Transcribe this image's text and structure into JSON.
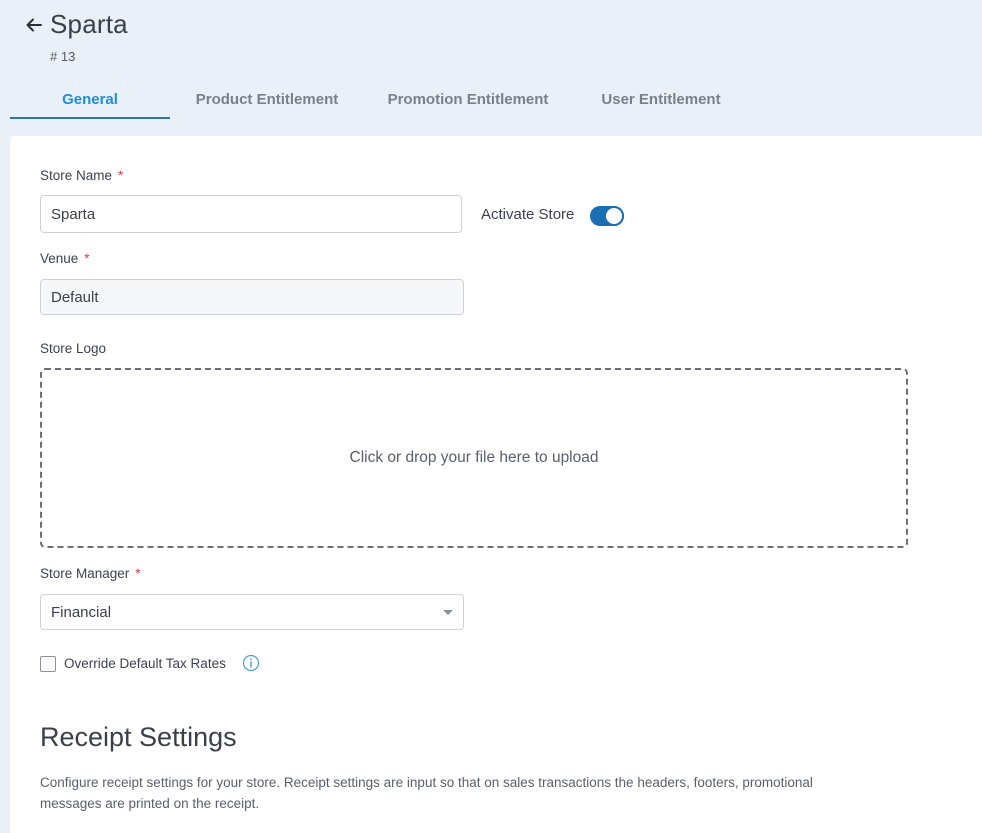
{
  "header": {
    "title": "Sparta",
    "subtitle": "# 13"
  },
  "tabs": [
    {
      "label": "General",
      "active": true
    },
    {
      "label": "Product Entitlement",
      "active": false
    },
    {
      "label": "Promotion Entitlement",
      "active": false
    },
    {
      "label": "User Entitlement",
      "active": false
    }
  ],
  "form": {
    "store_name_label": "Store Name",
    "store_name_value": "Sparta",
    "required_mark": "*",
    "activate_label": "Activate Store",
    "activate_on": true,
    "venue_label": "Venue",
    "venue_value": "Default",
    "logo_label": "Store Logo",
    "dropzone_text": "Click or drop your file here to upload",
    "manager_label": "Store Manager",
    "manager_value": "Financial",
    "override_label": "Override Default Tax Rates",
    "override_checked": false
  },
  "receipt": {
    "title": "Receipt Settings",
    "description": "Configure receipt settings for your store. Receipt settings are input so that on sales transactions the headers, footers, promotional messages are printed on the receipt."
  },
  "colors": {
    "accent": "#1f8fd6",
    "toggle": "#1a6fb3",
    "required": "#e0384b",
    "background": "#e9f0f8"
  },
  "icons": {
    "back": "arrow-left-icon",
    "info": "info-circle-icon",
    "dropdown": "caret-down-icon"
  }
}
